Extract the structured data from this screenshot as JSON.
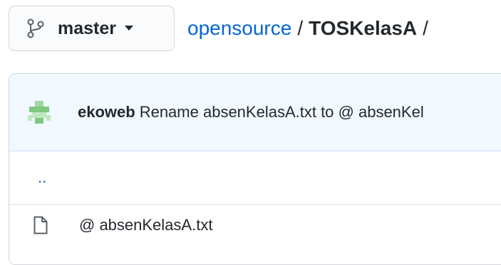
{
  "branch": {
    "name": "master",
    "icon": "git-branch-icon"
  },
  "breadcrumb": {
    "owner": "opensource",
    "separator1": "/",
    "repo": "TOSKelasA",
    "separator2": "/"
  },
  "commit": {
    "author": "ekoweb",
    "message": "Rename absenKelasA.txt to @ absenKel",
    "avatar_color": "#7dc97d"
  },
  "files": {
    "parent_link": "..",
    "items": [
      {
        "name": "@ absenKelasA.txt",
        "icon": "file-icon"
      }
    ]
  },
  "colors": {
    "link": "#0366d6",
    "commit_bg": "#f1f8ff",
    "border": "#d1d5da"
  }
}
